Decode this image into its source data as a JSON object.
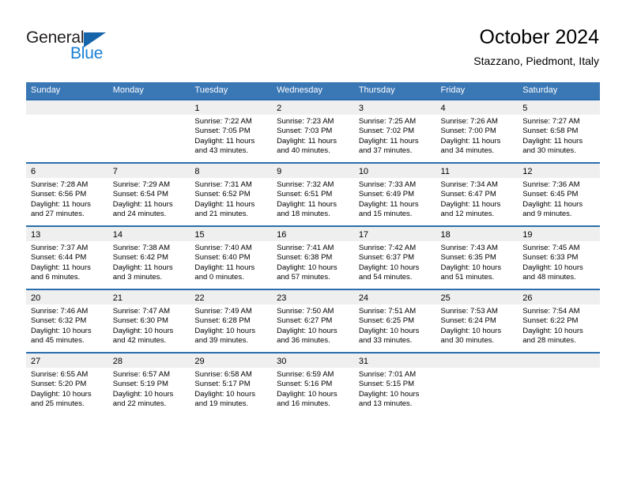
{
  "brand": {
    "name_part1": "General",
    "name_part2": "Blue",
    "triangle_icon": "blue-triangle-logo-mark"
  },
  "header": {
    "title": "October 2024",
    "location": "Stazzano, Piedmont, Italy"
  },
  "colors": {
    "header_blue": "#3a77b5",
    "rule_blue": "#2a6ead",
    "daynum_band": "#efefef",
    "logo_blue": "#1a7fd4",
    "logo_triangle": "#1665ab",
    "text": "#000000"
  },
  "weekday_headers": [
    "Sunday",
    "Monday",
    "Tuesday",
    "Wednesday",
    "Thursday",
    "Friday",
    "Saturday"
  ],
  "weeks": [
    [
      {
        "day": "",
        "sunrise": "",
        "sunset": "",
        "daylight1": "",
        "daylight2": ""
      },
      {
        "day": "",
        "sunrise": "",
        "sunset": "",
        "daylight1": "",
        "daylight2": ""
      },
      {
        "day": "1",
        "sunrise": "Sunrise: 7:22 AM",
        "sunset": "Sunset: 7:05 PM",
        "daylight1": "Daylight: 11 hours",
        "daylight2": "and 43 minutes."
      },
      {
        "day": "2",
        "sunrise": "Sunrise: 7:23 AM",
        "sunset": "Sunset: 7:03 PM",
        "daylight1": "Daylight: 11 hours",
        "daylight2": "and 40 minutes."
      },
      {
        "day": "3",
        "sunrise": "Sunrise: 7:25 AM",
        "sunset": "Sunset: 7:02 PM",
        "daylight1": "Daylight: 11 hours",
        "daylight2": "and 37 minutes."
      },
      {
        "day": "4",
        "sunrise": "Sunrise: 7:26 AM",
        "sunset": "Sunset: 7:00 PM",
        "daylight1": "Daylight: 11 hours",
        "daylight2": "and 34 minutes."
      },
      {
        "day": "5",
        "sunrise": "Sunrise: 7:27 AM",
        "sunset": "Sunset: 6:58 PM",
        "daylight1": "Daylight: 11 hours",
        "daylight2": "and 30 minutes."
      }
    ],
    [
      {
        "day": "6",
        "sunrise": "Sunrise: 7:28 AM",
        "sunset": "Sunset: 6:56 PM",
        "daylight1": "Daylight: 11 hours",
        "daylight2": "and 27 minutes."
      },
      {
        "day": "7",
        "sunrise": "Sunrise: 7:29 AM",
        "sunset": "Sunset: 6:54 PM",
        "daylight1": "Daylight: 11 hours",
        "daylight2": "and 24 minutes."
      },
      {
        "day": "8",
        "sunrise": "Sunrise: 7:31 AM",
        "sunset": "Sunset: 6:52 PM",
        "daylight1": "Daylight: 11 hours",
        "daylight2": "and 21 minutes."
      },
      {
        "day": "9",
        "sunrise": "Sunrise: 7:32 AM",
        "sunset": "Sunset: 6:51 PM",
        "daylight1": "Daylight: 11 hours",
        "daylight2": "and 18 minutes."
      },
      {
        "day": "10",
        "sunrise": "Sunrise: 7:33 AM",
        "sunset": "Sunset: 6:49 PM",
        "daylight1": "Daylight: 11 hours",
        "daylight2": "and 15 minutes."
      },
      {
        "day": "11",
        "sunrise": "Sunrise: 7:34 AM",
        "sunset": "Sunset: 6:47 PM",
        "daylight1": "Daylight: 11 hours",
        "daylight2": "and 12 minutes."
      },
      {
        "day": "12",
        "sunrise": "Sunrise: 7:36 AM",
        "sunset": "Sunset: 6:45 PM",
        "daylight1": "Daylight: 11 hours",
        "daylight2": "and 9 minutes."
      }
    ],
    [
      {
        "day": "13",
        "sunrise": "Sunrise: 7:37 AM",
        "sunset": "Sunset: 6:44 PM",
        "daylight1": "Daylight: 11 hours",
        "daylight2": "and 6 minutes."
      },
      {
        "day": "14",
        "sunrise": "Sunrise: 7:38 AM",
        "sunset": "Sunset: 6:42 PM",
        "daylight1": "Daylight: 11 hours",
        "daylight2": "and 3 minutes."
      },
      {
        "day": "15",
        "sunrise": "Sunrise: 7:40 AM",
        "sunset": "Sunset: 6:40 PM",
        "daylight1": "Daylight: 11 hours",
        "daylight2": "and 0 minutes."
      },
      {
        "day": "16",
        "sunrise": "Sunrise: 7:41 AM",
        "sunset": "Sunset: 6:38 PM",
        "daylight1": "Daylight: 10 hours",
        "daylight2": "and 57 minutes."
      },
      {
        "day": "17",
        "sunrise": "Sunrise: 7:42 AM",
        "sunset": "Sunset: 6:37 PM",
        "daylight1": "Daylight: 10 hours",
        "daylight2": "and 54 minutes."
      },
      {
        "day": "18",
        "sunrise": "Sunrise: 7:43 AM",
        "sunset": "Sunset: 6:35 PM",
        "daylight1": "Daylight: 10 hours",
        "daylight2": "and 51 minutes."
      },
      {
        "day": "19",
        "sunrise": "Sunrise: 7:45 AM",
        "sunset": "Sunset: 6:33 PM",
        "daylight1": "Daylight: 10 hours",
        "daylight2": "and 48 minutes."
      }
    ],
    [
      {
        "day": "20",
        "sunrise": "Sunrise: 7:46 AM",
        "sunset": "Sunset: 6:32 PM",
        "daylight1": "Daylight: 10 hours",
        "daylight2": "and 45 minutes."
      },
      {
        "day": "21",
        "sunrise": "Sunrise: 7:47 AM",
        "sunset": "Sunset: 6:30 PM",
        "daylight1": "Daylight: 10 hours",
        "daylight2": "and 42 minutes."
      },
      {
        "day": "22",
        "sunrise": "Sunrise: 7:49 AM",
        "sunset": "Sunset: 6:28 PM",
        "daylight1": "Daylight: 10 hours",
        "daylight2": "and 39 minutes."
      },
      {
        "day": "23",
        "sunrise": "Sunrise: 7:50 AM",
        "sunset": "Sunset: 6:27 PM",
        "daylight1": "Daylight: 10 hours",
        "daylight2": "and 36 minutes."
      },
      {
        "day": "24",
        "sunrise": "Sunrise: 7:51 AM",
        "sunset": "Sunset: 6:25 PM",
        "daylight1": "Daylight: 10 hours",
        "daylight2": "and 33 minutes."
      },
      {
        "day": "25",
        "sunrise": "Sunrise: 7:53 AM",
        "sunset": "Sunset: 6:24 PM",
        "daylight1": "Daylight: 10 hours",
        "daylight2": "and 30 minutes."
      },
      {
        "day": "26",
        "sunrise": "Sunrise: 7:54 AM",
        "sunset": "Sunset: 6:22 PM",
        "daylight1": "Daylight: 10 hours",
        "daylight2": "and 28 minutes."
      }
    ],
    [
      {
        "day": "27",
        "sunrise": "Sunrise: 6:55 AM",
        "sunset": "Sunset: 5:20 PM",
        "daylight1": "Daylight: 10 hours",
        "daylight2": "and 25 minutes."
      },
      {
        "day": "28",
        "sunrise": "Sunrise: 6:57 AM",
        "sunset": "Sunset: 5:19 PM",
        "daylight1": "Daylight: 10 hours",
        "daylight2": "and 22 minutes."
      },
      {
        "day": "29",
        "sunrise": "Sunrise: 6:58 AM",
        "sunset": "Sunset: 5:17 PM",
        "daylight1": "Daylight: 10 hours",
        "daylight2": "and 19 minutes."
      },
      {
        "day": "30",
        "sunrise": "Sunrise: 6:59 AM",
        "sunset": "Sunset: 5:16 PM",
        "daylight1": "Daylight: 10 hours",
        "daylight2": "and 16 minutes."
      },
      {
        "day": "31",
        "sunrise": "Sunrise: 7:01 AM",
        "sunset": "Sunset: 5:15 PM",
        "daylight1": "Daylight: 10 hours",
        "daylight2": "and 13 minutes."
      },
      {
        "day": "",
        "sunrise": "",
        "sunset": "",
        "daylight1": "",
        "daylight2": ""
      },
      {
        "day": "",
        "sunrise": "",
        "sunset": "",
        "daylight1": "",
        "daylight2": ""
      }
    ]
  ]
}
